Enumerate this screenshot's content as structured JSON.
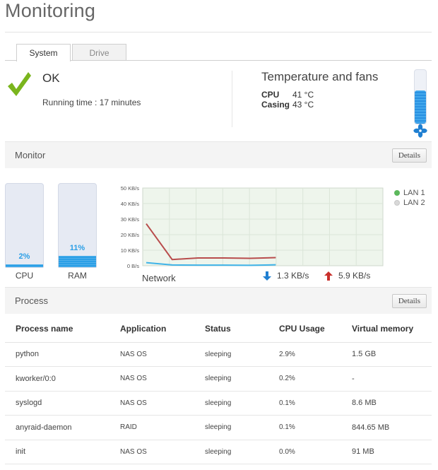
{
  "page": {
    "title": "Monitoring"
  },
  "tabs": [
    {
      "label": "System",
      "active": true
    },
    {
      "label": "Drive",
      "active": false
    }
  ],
  "status": {
    "label": "OK",
    "running_time": "Running time : 17 minutes"
  },
  "temperature": {
    "title": "Temperature and fans",
    "cpu_label": "CPU",
    "cpu_value": "41 °C",
    "casing_label": "Casing",
    "casing_value": "43 °C"
  },
  "monitor": {
    "title": "Monitor",
    "details_label": "Details"
  },
  "gauges": {
    "cpu": {
      "value": "2%",
      "percent": 2,
      "label": "CPU"
    },
    "ram": {
      "value": "11%",
      "percent": 11,
      "label": "RAM"
    }
  },
  "network": {
    "label": "Network",
    "download_rate": "1.3 KB/s",
    "upload_rate": "5.9 KB/s",
    "legend": [
      {
        "name": "LAN 1",
        "color": "#5cb85c"
      },
      {
        "name": "LAN 2",
        "color": "#d9d9d9"
      }
    ],
    "colors": {
      "download": "#3fb3e8",
      "upload": "#b84c4c",
      "plot_bg": "#eef5ec",
      "up_arrow": "#c9302c",
      "down_arrow": "#1f7fd1"
    }
  },
  "chart_data": {
    "type": "line",
    "ylabel": "",
    "xlabel": "Network",
    "y_ticks": [
      "0 B/s",
      "10 KB/s",
      "20 KB/s",
      "30 KB/s",
      "40 KB/s",
      "50 KB/s"
    ],
    "ylim": [
      0,
      50
    ],
    "grid": true,
    "x": [
      0,
      1,
      2,
      3,
      4,
      5
    ],
    "series": [
      {
        "color": "#b84c4c",
        "values": [
          27,
          4,
          5,
          5,
          4.8,
          5.2
        ]
      },
      {
        "color": "#3fb3e8",
        "values": [
          2,
          0.5,
          0.4,
          0.4,
          0.3,
          0.6
        ]
      }
    ]
  },
  "process": {
    "title": "Process",
    "details_label": "Details",
    "columns": [
      "Process name",
      "Application",
      "Status",
      "CPU Usage",
      "Virtual memory"
    ],
    "rows": [
      [
        "python",
        "NAS OS",
        "sleeping",
        "2.9%",
        "1.5 GB"
      ],
      [
        "kworker/0:0",
        "NAS OS",
        "sleeping",
        "0.2%",
        "-"
      ],
      [
        "syslogd",
        "NAS OS",
        "sleeping",
        "0.1%",
        "8.6 MB"
      ],
      [
        "anyraid-daemon",
        "RAID",
        "sleeping",
        "0.1%",
        "844.65 MB"
      ],
      [
        "init",
        "NAS OS",
        "sleeping",
        "0.0%",
        "91 MB"
      ]
    ]
  }
}
